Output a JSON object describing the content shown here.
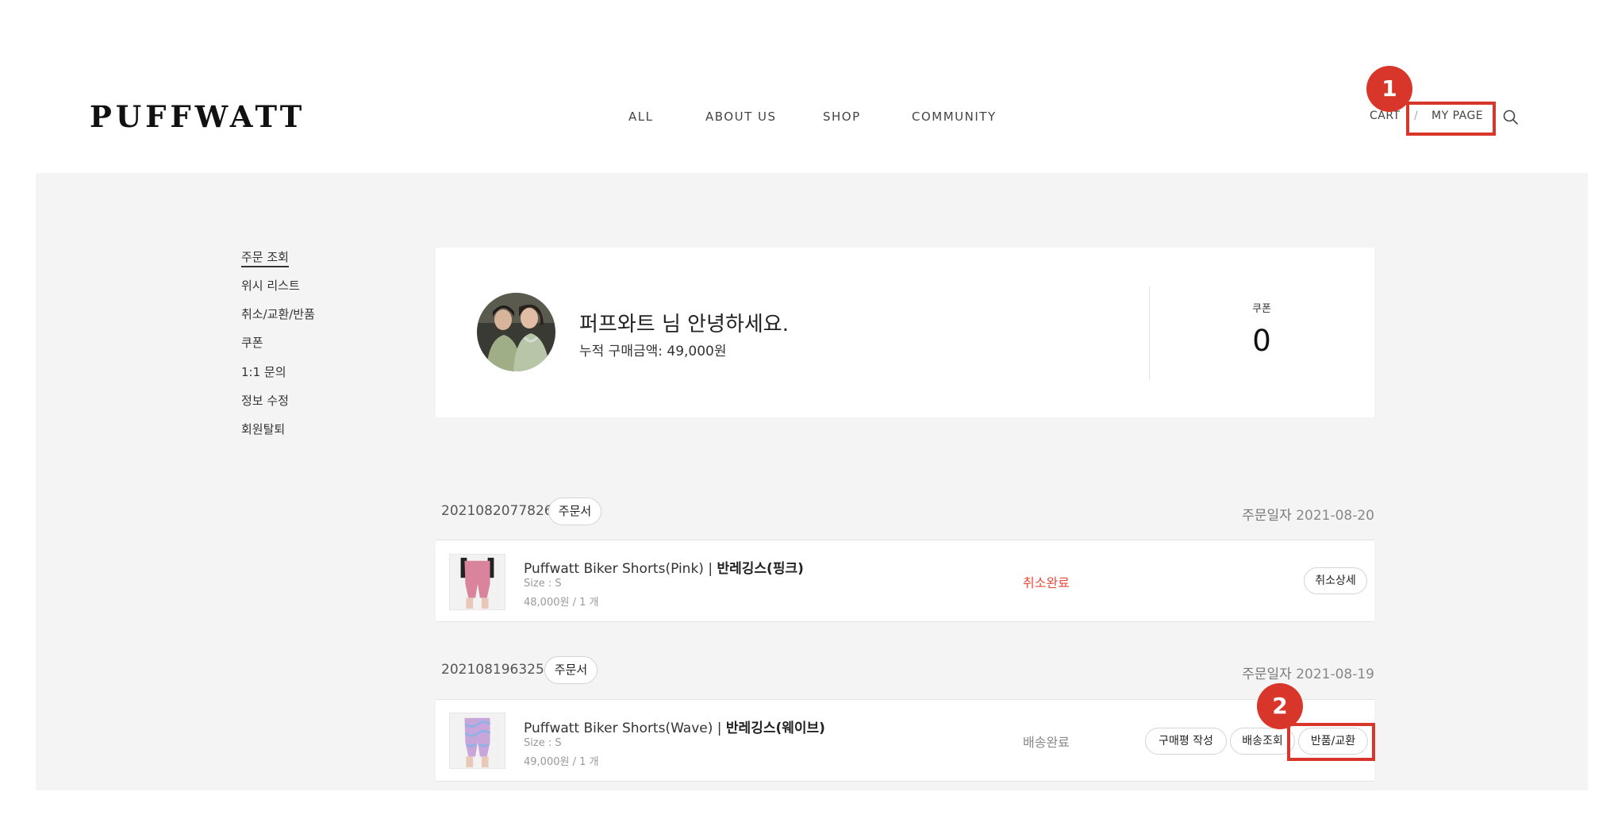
{
  "header": {
    "logo": "PUFFWATT",
    "nav": [
      "ALL",
      "ABOUT US",
      "SHOP",
      "COMMUNITY"
    ],
    "cart": "CART",
    "sep": "/",
    "mypage": "MY PAGE"
  },
  "sidebar": {
    "items": [
      "주문 조회",
      "위시 리스트",
      "취소/교환/반품",
      "쿠폰",
      "1:1 문의",
      "정보 수정",
      "회원탈퇴"
    ]
  },
  "profile": {
    "greeting": "퍼프와트 님 안녕하세요.",
    "total_label": "누적 구매금액: 49,000원",
    "coupon_label": "쿠폰",
    "coupon_count": "0"
  },
  "orders": [
    {
      "number": "2021082077826",
      "receipt_label": "주문서",
      "date_label": "주문일자",
      "date": "2021-08-20",
      "item": {
        "name": "Puffwatt Biker Shorts(Pink) | ",
        "name_kr": "반레깅스(핑크)",
        "size": "Size : S",
        "price": "48,000원 / 1 개",
        "status": "취소완료",
        "actions": [
          "취소상세"
        ]
      }
    },
    {
      "number": "2021081963250",
      "receipt_label": "주문서",
      "date_label": "주문일자",
      "date": "2021-08-19",
      "item": {
        "name": "Puffwatt Biker Shorts(Wave) | ",
        "name_kr": "반레깅스(웨이브)",
        "size": "Size : S",
        "price": "49,000원 / 1 개",
        "status": "배송완료",
        "actions": [
          "구매평 작성",
          "배송조회",
          "반품/교환"
        ]
      }
    }
  ],
  "annotations": {
    "badge1": "1",
    "badge2": "2"
  },
  "colors": {
    "accent": "#d9362b",
    "cancel_status": "#e84c3d",
    "gray_bg": "#f4f4f5"
  }
}
